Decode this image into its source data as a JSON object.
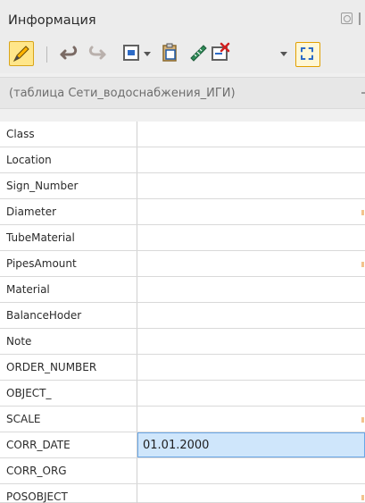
{
  "panel": {
    "title": "Информация"
  },
  "toolbar": {
    "items": [
      "edit-pencil-icon",
      "undo-icon",
      "redo-icon",
      "window-layout-icon",
      "clipboard-icon",
      "ruler-icon",
      "delete-attribute-icon",
      "select-area-icon"
    ]
  },
  "filter": {
    "text": "(таблица Сети_водоснабжения_ИГИ)"
  },
  "attributes": [
    {
      "name": "Class",
      "value": ""
    },
    {
      "name": "Location",
      "value": ""
    },
    {
      "name": "Sign_Number",
      "value": ""
    },
    {
      "name": "Diameter",
      "value": ""
    },
    {
      "name": "TubeMaterial",
      "value": ""
    },
    {
      "name": "PipesAmount",
      "value": ""
    },
    {
      "name": "Material",
      "value": ""
    },
    {
      "name": "BalanceHoder",
      "value": ""
    },
    {
      "name": "Note",
      "value": ""
    },
    {
      "name": "ORDER_NUMBER",
      "value": ""
    },
    {
      "name": "OBJECT_",
      "value": ""
    },
    {
      "name": "SCALE",
      "value": ""
    },
    {
      "name": "CORR_DATE",
      "value": "01.01.2000"
    },
    {
      "name": "CORR_ORG",
      "value": ""
    },
    {
      "name": "POSOBJECT",
      "value": ""
    }
  ],
  "colors": {
    "selection_fill": "#cfe6fb",
    "selection_border": "#6aa7e6",
    "accent": "#f2c38d"
  }
}
